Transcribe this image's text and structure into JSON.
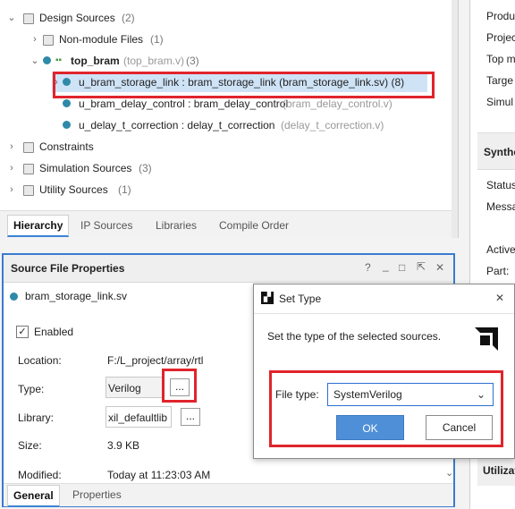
{
  "hierarchy": {
    "design_sources": {
      "label": "Design Sources",
      "count": "(2)"
    },
    "non_module": {
      "label": "Non-module Files",
      "count": "(1)"
    },
    "top_bram": {
      "label": "top_bram",
      "file": "(top_bram.v)",
      "count": "(3)"
    },
    "children": [
      {
        "text": "u_bram_storage_link : bram_storage_link (bram_storage_link.sv) (8)"
      },
      {
        "text": "u_bram_delay_control : bram_delay_control",
        "file": "(bram_delay_control.v)"
      },
      {
        "text": "u_delay_t_correction : delay_t_correction",
        "file": "(delay_t_correction.v)"
      }
    ],
    "constraints": {
      "label": "Constraints"
    },
    "sim_sources": {
      "label": "Simulation Sources",
      "count": "(3)"
    },
    "utility_sources": {
      "label": "Utility Sources",
      "count": "(1)"
    }
  },
  "top_tabs": [
    "Hierarchy",
    "IP Sources",
    "Libraries",
    "Compile Order"
  ],
  "right_panel": {
    "items_top": [
      "Produ",
      "Projec",
      "Top m",
      "Targe",
      "Simul"
    ],
    "section1": "Synthe",
    "items_mid": [
      "Status",
      "Messa"
    ],
    "items_low": [
      "Active",
      "Part:"
    ],
    "section2": "Utilizat"
  },
  "sfp": {
    "title": "Source File Properties",
    "icons": {
      "help": "?",
      "minimize": "_",
      "restore": "□",
      "popout": "⇱",
      "close": "✕"
    },
    "file": "bram_storage_link.sv",
    "enabled": "Enabled",
    "location_label": "Location:",
    "location_value": "F:/L_project/array/rtl",
    "type_label": "Type:",
    "type_value": "Verilog",
    "library_label": "Library:",
    "library_value": "xil_defaultlib",
    "size_label": "Size:",
    "size_value": "3.9 KB",
    "modified_label": "Modified:",
    "modified_value": "Today at 11:23:03 AM",
    "ellipsis": "...",
    "tabs": [
      "General",
      "Properties"
    ]
  },
  "dialog": {
    "title": "Set Type",
    "message": "Set the type of the selected sources.",
    "file_type_label": "File type:",
    "file_type_value": "SystemVerilog",
    "ok": "OK",
    "cancel": "Cancel",
    "close": "✕"
  },
  "colors": {
    "accent": "#3a7bd0",
    "highlight": "#e0242c",
    "selection": "#cfe3f7"
  }
}
